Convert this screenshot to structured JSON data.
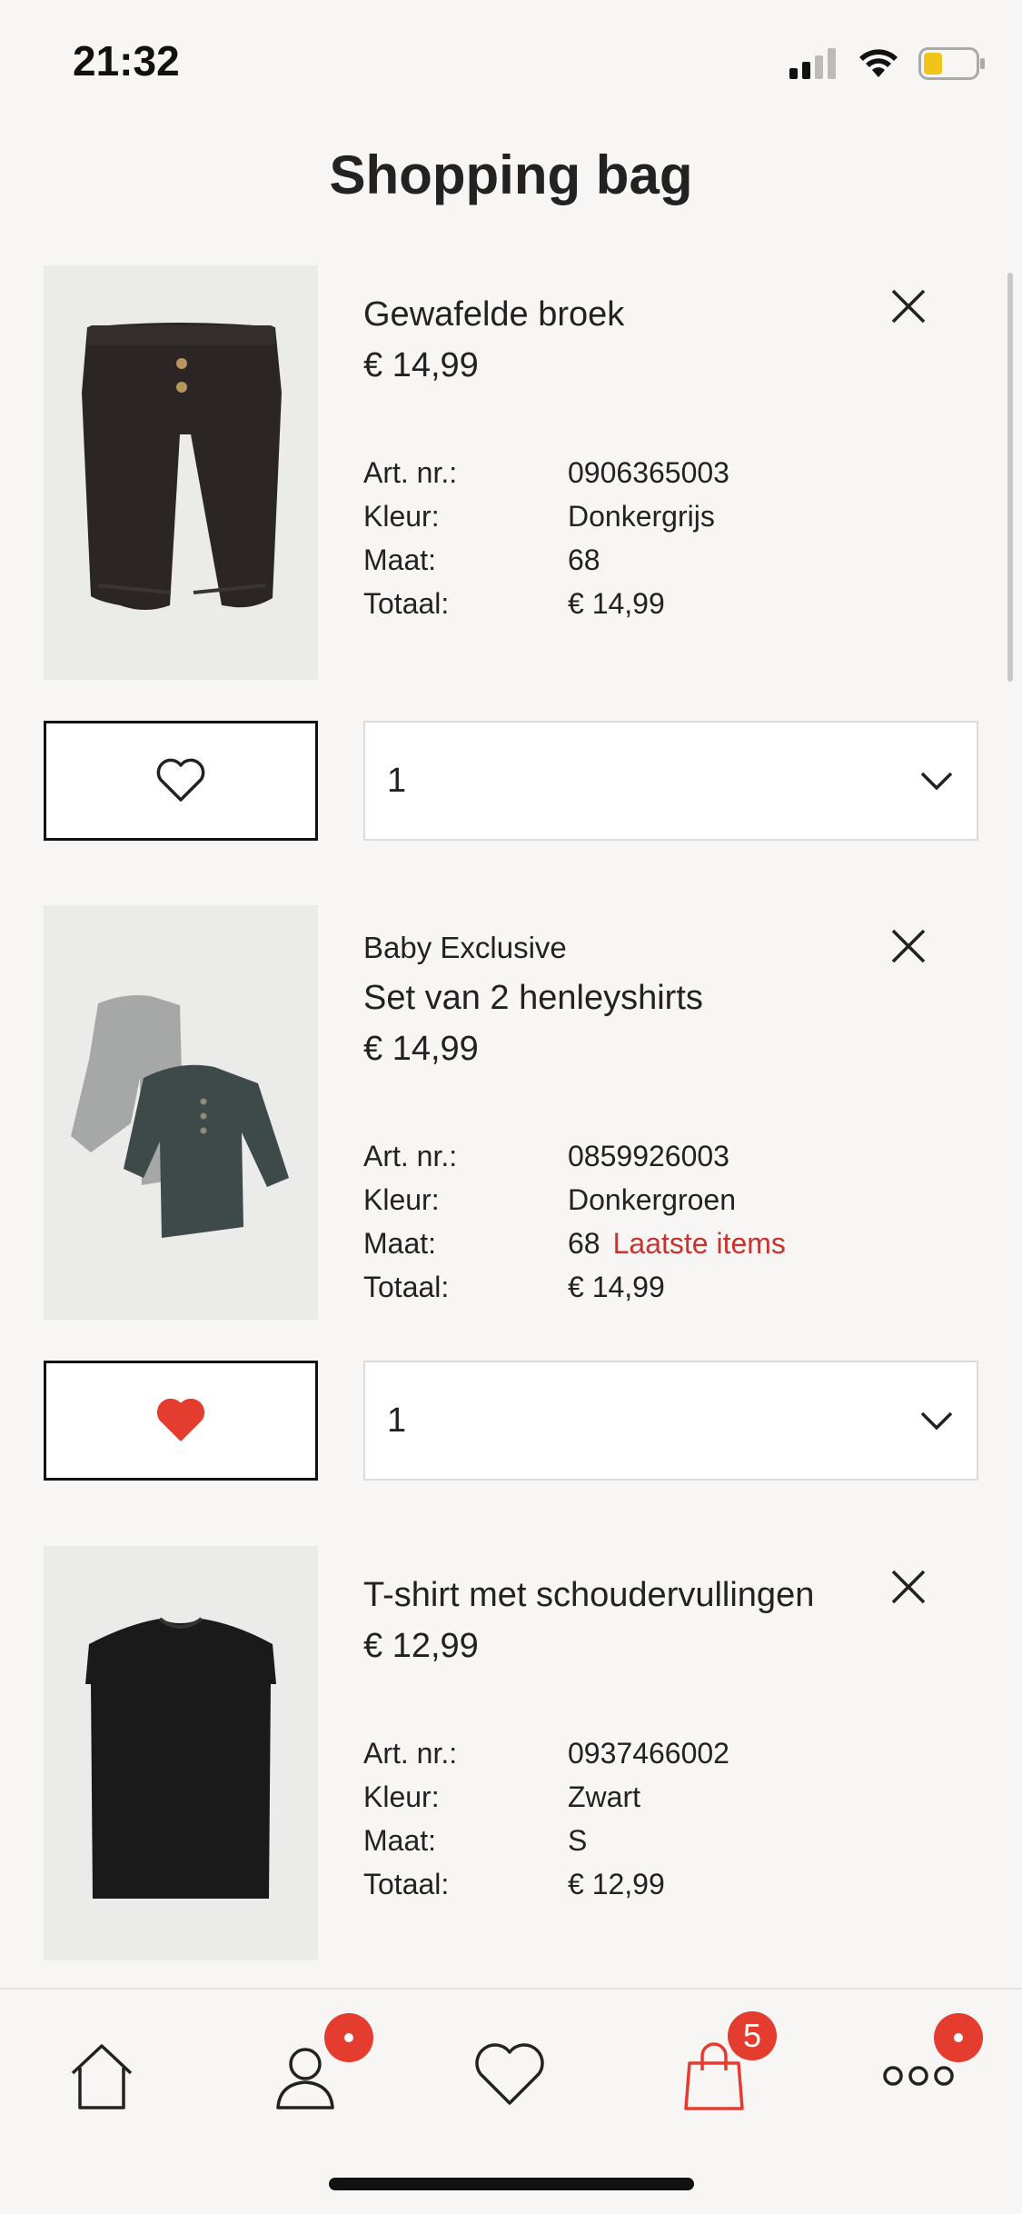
{
  "status": {
    "time": "21:32"
  },
  "header": {
    "title": "Shopping bag"
  },
  "labels": {
    "art_nr": "Art. nr.:",
    "kleur": "Kleur:",
    "maat": "Maat:",
    "totaal": "Totaal:"
  },
  "items": [
    {
      "brand": "",
      "name": "Gewafelde broek",
      "price": "€ 14,99",
      "art_nr": "0906365003",
      "color": "Donkergrijs",
      "size": "68",
      "size_note": "",
      "total": "€ 14,99",
      "quantity": "1",
      "favorited": false,
      "image_icon": "pants-image"
    },
    {
      "brand": "Baby Exclusive",
      "name": "Set van 2 henleyshirts",
      "price": "€ 14,99",
      "art_nr": "0859926003",
      "color": "Donkergroen",
      "size": "68",
      "size_note": "Laatste items",
      "total": "€ 14,99",
      "quantity": "1",
      "favorited": true,
      "image_icon": "henley-shirts-image"
    },
    {
      "brand": "",
      "name": "T-shirt met schoudervullingen",
      "price": "€ 12,99",
      "art_nr": "0937466002",
      "color": "Zwart",
      "size": "S",
      "size_note": "",
      "total": "€ 12,99",
      "quantity": "1",
      "favorited": false,
      "image_icon": "tshirt-image"
    }
  ],
  "tab_bar": {
    "tabs": [
      {
        "name": "home",
        "icon": "home-icon",
        "badge": ""
      },
      {
        "name": "account",
        "icon": "user-icon",
        "badge": "dot"
      },
      {
        "name": "favourites",
        "icon": "heart-icon",
        "badge": ""
      },
      {
        "name": "bag",
        "icon": "shopping-bag-icon",
        "badge": "5",
        "active": true
      },
      {
        "name": "more",
        "icon": "more-icon",
        "badge": "dot"
      }
    ]
  },
  "colors": {
    "accent_red": "#e43c2f",
    "warning_text": "#c8332d",
    "background": "#f7f6f4"
  }
}
